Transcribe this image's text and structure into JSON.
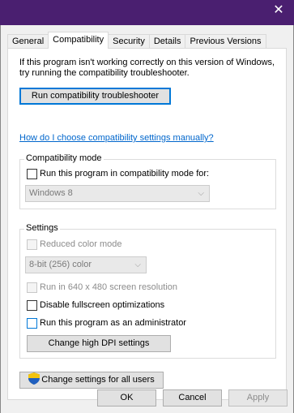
{
  "window": {
    "close_glyph": "✕"
  },
  "tabs": [
    {
      "label": "General"
    },
    {
      "label": "Compatibility"
    },
    {
      "label": "Security"
    },
    {
      "label": "Details"
    },
    {
      "label": "Previous Versions"
    }
  ],
  "intro": {
    "line1": "If this program isn't working correctly on this version of Windows,",
    "line2": "try running the compatibility troubleshooter."
  },
  "troubleshooter_button": "Run compatibility troubleshooter",
  "manual_link": "How do I choose compatibility settings manually?",
  "compat_mode": {
    "group_label": "Compatibility mode",
    "checkbox_label": "Run this program in compatibility mode for:",
    "select_value": "Windows 8"
  },
  "settings": {
    "group_label": "Settings",
    "reduced_color": "Reduced color mode",
    "color_select_value": "8-bit (256) color",
    "resolution": "Run in 640 x 480 screen resolution",
    "fullscreen": "Disable fullscreen optimizations",
    "admin": "Run this program as an administrator",
    "dpi_button": "Change high DPI settings"
  },
  "all_users_button": "Change settings for all users",
  "footer": {
    "ok": "OK",
    "cancel": "Cancel",
    "apply": "Apply"
  },
  "colors": {
    "titlebar": "#4a1f70",
    "link": "#0066cc",
    "focus": "#0078d7"
  }
}
